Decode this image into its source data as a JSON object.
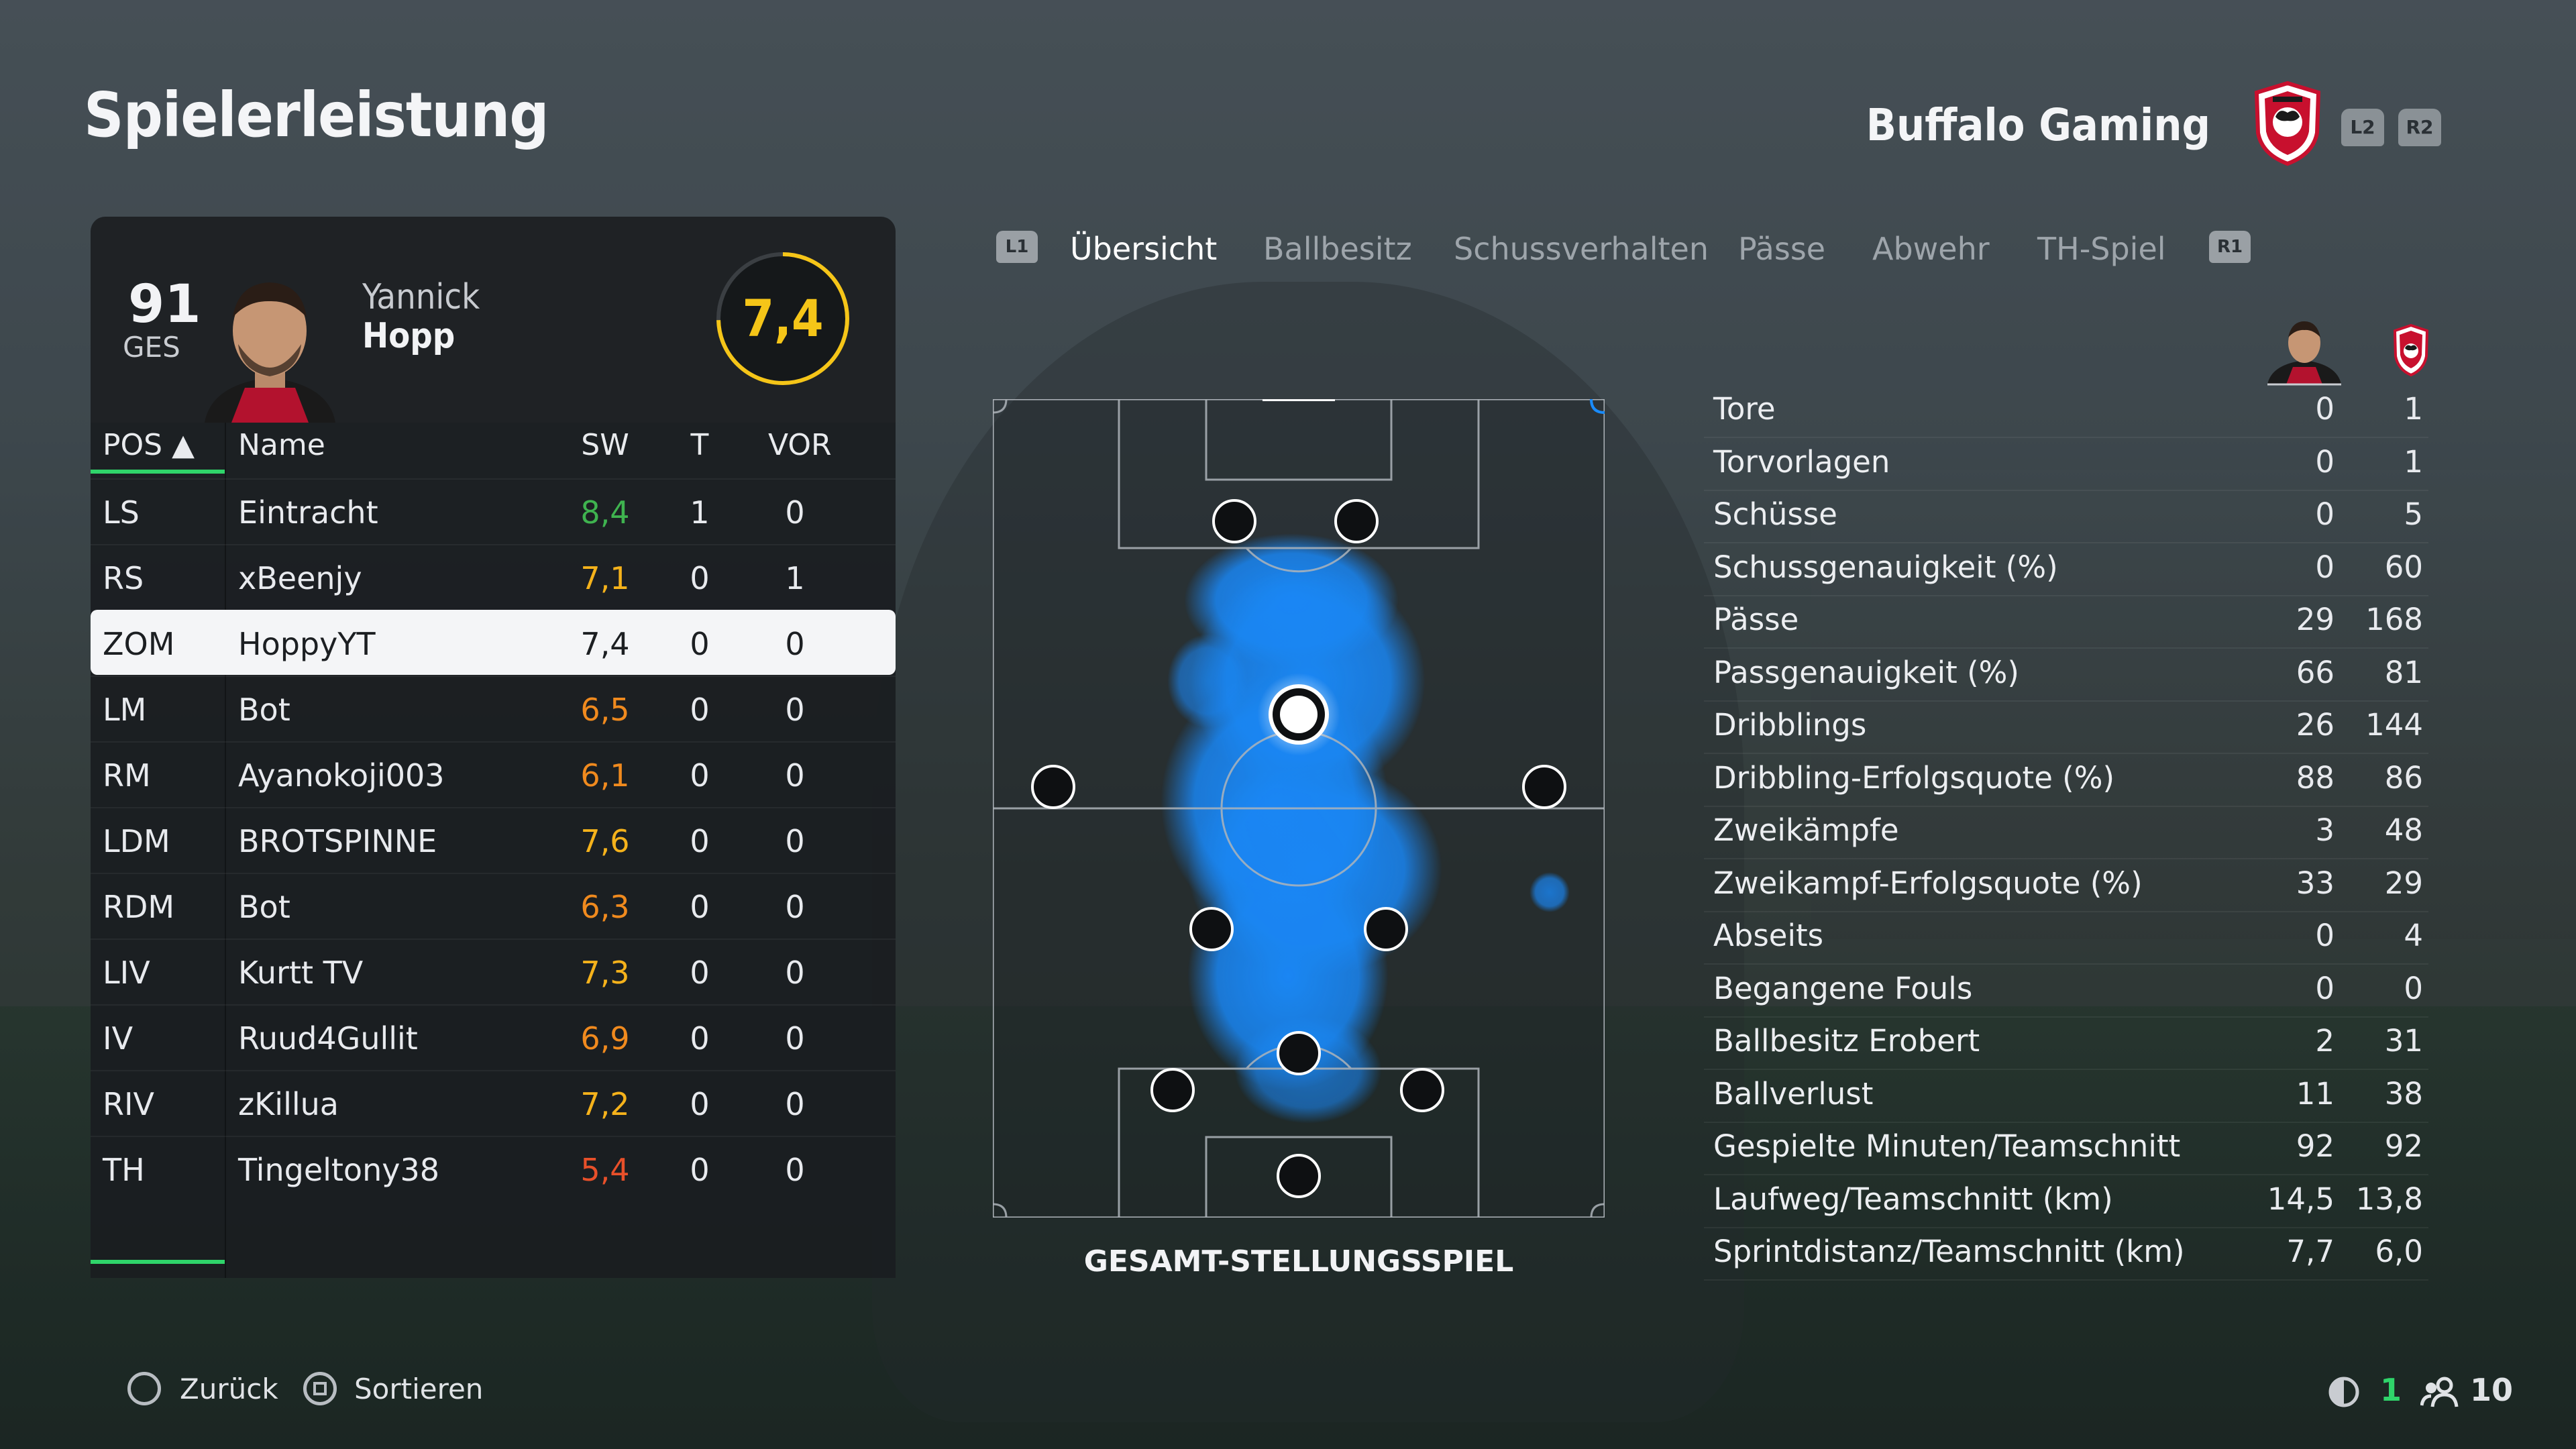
{
  "title": "Spielerleistung",
  "team": {
    "name": "Buffalo Gaming",
    "shoulder_left": "L2",
    "shoulder_right": "R2",
    "crest_icon": "buffalo-crest-icon"
  },
  "player": {
    "ovr": "91",
    "ovr_label": "GES",
    "first_name": "Yannick",
    "last_name": "Hopp",
    "rating": "7,4",
    "rating_color": "#f5c518"
  },
  "table": {
    "headers": {
      "pos": "POS ▲",
      "name": "Name",
      "sw": "SW",
      "t": "T",
      "vor": "VOR"
    },
    "rows": [
      {
        "pos": "LS",
        "name": "Eintracht",
        "sw": "8,4",
        "t": "1",
        "vor": "0",
        "sw_color": "#3fb34f"
      },
      {
        "pos": "RS",
        "name": "xBeenjy",
        "sw": "7,1",
        "t": "0",
        "vor": "1",
        "sw_color": "#f5b21b"
      },
      {
        "pos": "ZOM",
        "name": "HoppyYT",
        "sw": "7,4",
        "t": "0",
        "vor": "0",
        "sw_color": "#1c1f22"
      },
      {
        "pos": "LM",
        "name": "Bot",
        "sw": "6,5",
        "t": "0",
        "vor": "0",
        "sw_color": "#f08a1e"
      },
      {
        "pos": "RM",
        "name": "Ayanokoji003",
        "sw": "6,1",
        "t": "0",
        "vor": "0",
        "sw_color": "#f08a1e"
      },
      {
        "pos": "LDM",
        "name": "BROTSPINNE",
        "sw": "7,6",
        "t": "0",
        "vor": "0",
        "sw_color": "#f5b21b"
      },
      {
        "pos": "RDM",
        "name": "Bot",
        "sw": "6,3",
        "t": "0",
        "vor": "0",
        "sw_color": "#f08a1e"
      },
      {
        "pos": "LIV",
        "name": "Kurtt TV",
        "sw": "7,3",
        "t": "0",
        "vor": "0",
        "sw_color": "#f5b21b"
      },
      {
        "pos": "IV",
        "name": "Ruud4Gullit",
        "sw": "6,9",
        "t": "0",
        "vor": "0",
        "sw_color": "#f08a1e"
      },
      {
        "pos": "RIV",
        "name": "zKillua",
        "sw": "7,2",
        "t": "0",
        "vor": "0",
        "sw_color": "#f5b21b"
      },
      {
        "pos": "TH",
        "name": "Tingeltony38",
        "sw": "5,4",
        "t": "0",
        "vor": "0",
        "sw_color": "#e8502a"
      }
    ]
  },
  "tabs": {
    "left_button": "L1",
    "right_button": "R1",
    "items": [
      "Übersicht",
      "Ballbesitz",
      "Schussverhalten",
      "Pässe",
      "Abwehr",
      "TH-Spiel"
    ],
    "active": "Übersicht"
  },
  "pitch": {
    "caption": "GESAMT-STELLUNGSSPIEL",
    "heatmap_color": "#1a8cff"
  },
  "stats": [
    {
      "label": "Tore",
      "player": "0",
      "team": "1"
    },
    {
      "label": "Torvorlagen",
      "player": "0",
      "team": "1"
    },
    {
      "label": "Schüsse",
      "player": "0",
      "team": "5"
    },
    {
      "label": "Schussgenauigkeit (%)",
      "player": "0",
      "team": "60"
    },
    {
      "label": "Pässe",
      "player": "29",
      "team": "168"
    },
    {
      "label": "Passgenauigkeit (%)",
      "player": "66",
      "team": "81"
    },
    {
      "label": "Dribblings",
      "player": "26",
      "team": "144"
    },
    {
      "label": "Dribbling-Erfolgsquote (%)",
      "player": "88",
      "team": "86"
    },
    {
      "label": "Zweikämpfe",
      "player": "3",
      "team": "48"
    },
    {
      "label": "Zweikampf-Erfolgsquote (%)",
      "player": "33",
      "team": "29"
    },
    {
      "label": "Abseits",
      "player": "0",
      "team": "4"
    },
    {
      "label": "Begangene Fouls",
      "player": "0",
      "team": "0"
    },
    {
      "label": "Ballbesitz Erobert",
      "player": "2",
      "team": "31"
    },
    {
      "label": "Ballverlust",
      "player": "11",
      "team": "38"
    },
    {
      "label": "Gespielte Minuten/Teamschnitt",
      "player": "92",
      "team": "92"
    },
    {
      "label": "Laufweg/Teamschnitt (km)",
      "player": "14,5",
      "team": "13,8"
    },
    {
      "label": "Sprintdistanz/Teamschnitt (km)",
      "player": "7,7",
      "team": "6,0"
    }
  ],
  "footer": {
    "back_label": "Zurück",
    "sort_label": "Sortieren",
    "home_count": "1",
    "players_count": "10",
    "accent": "#2fd46a"
  }
}
